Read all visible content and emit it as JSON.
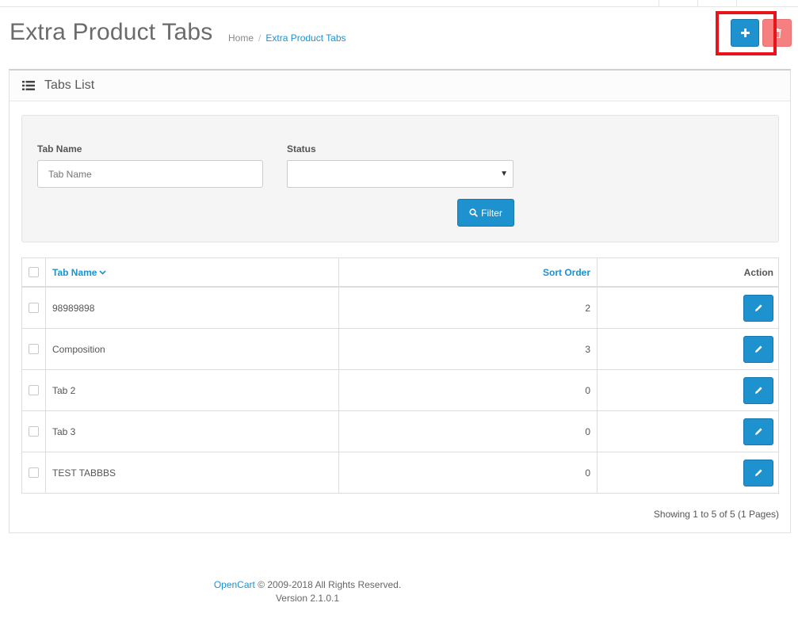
{
  "header": {
    "title": "Extra Product Tabs",
    "breadcrumb": [
      {
        "label": "Home"
      },
      {
        "label": "Extra Product Tabs"
      }
    ],
    "breadcrumb_separator": "/"
  },
  "panel": {
    "title": "Tabs List",
    "icon": "list-icon"
  },
  "filter": {
    "tab_name_label": "Tab Name",
    "tab_name_placeholder": "Tab Name",
    "status_label": "Status",
    "status_value": "",
    "filter_button_label": "Filter"
  },
  "table": {
    "columns": {
      "name": "Tab Name",
      "sort_order": "Sort Order",
      "action": "Action"
    },
    "rows": [
      {
        "name": "98989898",
        "sort_order": "2"
      },
      {
        "name": "Composition",
        "sort_order": "3"
      },
      {
        "name": "Tab 2",
        "sort_order": "0"
      },
      {
        "name": "Tab 3",
        "sort_order": "0"
      },
      {
        "name": "TEST TABBBS",
        "sort_order": "0"
      }
    ]
  },
  "pagination": {
    "showing_text": "Showing 1 to 5 of 5 (1 Pages)"
  },
  "footer": {
    "brand": "OpenCart",
    "copyright": "© 2009-2018 All Rights Reserved.",
    "version": "Version 2.1.0.1"
  },
  "colors": {
    "primary": "#1e91cf",
    "danger": "#f56b6b",
    "highlight": "#e8141c"
  }
}
